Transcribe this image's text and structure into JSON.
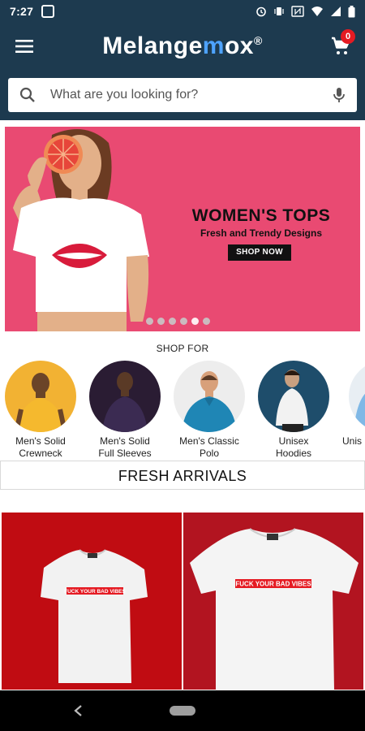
{
  "status_bar": {
    "time": "7:27"
  },
  "app_bar": {
    "brand_prefix": "Melange",
    "brand_highlight": "m",
    "brand_suffix": "ox",
    "brand_mark": "®",
    "cart_count": "0",
    "menu_icon": "hamburger-menu-icon",
    "cart_icon": "shopping-cart-icon"
  },
  "search": {
    "placeholder": "What are you looking for?",
    "search_icon": "search-icon",
    "mic_icon": "microphone-icon"
  },
  "banner": {
    "headline": "WOMEN'S TOPS",
    "subheadline": "Fresh and Trendy Designs",
    "cta": "SHOP NOW",
    "slide_count": 6,
    "active_slide": 5,
    "background_color": "#e94a72"
  },
  "shop_for": {
    "title": "SHOP FOR",
    "categories": [
      {
        "line1": "Men's Solid",
        "line2": "Crewneck"
      },
      {
        "line1": "Men's Solid",
        "line2": "Full Sleeves"
      },
      {
        "line1": "Men's Classic",
        "line2": "Polo"
      },
      {
        "line1": "Unisex",
        "line2": "Hoodies"
      },
      {
        "line1": "Unis",
        "line2": ""
      }
    ]
  },
  "fresh_arrivals": {
    "title": "FRESH ARRIVALS",
    "products": [
      {
        "print_text": "FUCK YOUR BAD VIBES",
        "tile_color": "#c00c12"
      },
      {
        "print_text": "FUCK YOUR BAD VIBES",
        "tile_color": "#b21420"
      }
    ]
  },
  "colors": {
    "header": "#1d3a4f",
    "brand_accent": "#4ea3ff",
    "cart_badge": "#e51b23"
  }
}
